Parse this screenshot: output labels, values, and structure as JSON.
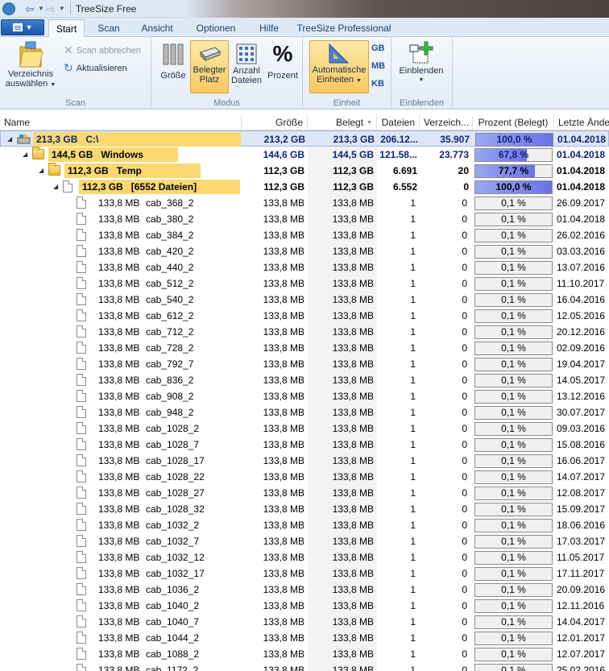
{
  "window": {
    "title": "TreeSize Free"
  },
  "tabs": [
    {
      "label": "Start",
      "active": true
    },
    {
      "label": "Scan",
      "active": false
    },
    {
      "label": "Ansicht",
      "active": false
    },
    {
      "label": "Optionen",
      "active": false
    },
    {
      "label": "Hilfe",
      "active": false
    },
    {
      "label": "TreeSize Professional",
      "active": false
    }
  ],
  "ribbon": {
    "scan": {
      "label": "Scan",
      "select_dir_line1": "Verzeichnis",
      "select_dir_line2": "auswählen",
      "abort": "Scan abbrechen",
      "refresh": "Aktualisieren"
    },
    "modus": {
      "label": "Modus",
      "groesse": "Größe",
      "belegter_line1": "Belegter",
      "belegter_line2": "Platz",
      "anzahl_line1": "Anzahl",
      "anzahl_line2": "Dateien",
      "prozent": "Prozent"
    },
    "einheit": {
      "label": "Einheit",
      "auto_line1": "Automatische",
      "auto_line2": "Einheiten",
      "gb": "GB",
      "mb": "MB",
      "kb": "KB"
    },
    "einblenden": {
      "label": "Einblenden",
      "button": "Einblenden"
    }
  },
  "columns": {
    "name": "Name",
    "groesse": "Größe",
    "belegt": "Belegt",
    "dateien": "Dateien",
    "verzeich": "Verzeich...",
    "prozent": "Prozent (Belegt)",
    "letzte": "Letzte Ände"
  },
  "tree": [
    {
      "level": 0,
      "icon": "drive",
      "label_size": "213,3 GB",
      "label_name": "C:\\",
      "size": "213,2 GB",
      "belegt": "213,3 GB",
      "dateien": "206.12...",
      "verzeich": "35.907",
      "prozent": "100,0 %",
      "pct_value": 100,
      "date": "01.04.2018"
    },
    {
      "level": 1,
      "icon": "folder",
      "label_size": "144,5 GB",
      "label_name": "Windows",
      "size": "144,6 GB",
      "belegt": "144,5 GB",
      "dateien": "121.58...",
      "verzeich": "23.773",
      "prozent": "67,8 %",
      "pct_value": 67.8,
      "date": "01.04.2018"
    },
    {
      "level": 2,
      "icon": "folder",
      "label_size": "112,3 GB",
      "label_name": "Temp",
      "size": "112,3 GB",
      "belegt": "112,3 GB",
      "dateien": "6.691",
      "verzeich": "20",
      "prozent": "77,7 %",
      "pct_value": 77.7,
      "date": "01.04.2018"
    },
    {
      "level": 3,
      "icon": "file",
      "label_size": "112,3 GB",
      "label_name": "[6552 Dateien]",
      "size": "112,3 GB",
      "belegt": "112,3 GB",
      "dateien": "6.552",
      "verzeich": "0",
      "prozent": "100,0 %",
      "pct_value": 100,
      "date": "01.04.2018"
    }
  ],
  "files": [
    {
      "size": "133,8 MB",
      "name": "cab_368_2",
      "date": "26.09.2017"
    },
    {
      "size": "133,8 MB",
      "name": "cab_380_2",
      "date": "01.04.2018"
    },
    {
      "size": "133,8 MB",
      "name": "cab_384_2",
      "date": "26.02.2016"
    },
    {
      "size": "133,8 MB",
      "name": "cab_420_2",
      "date": "03.03.2016"
    },
    {
      "size": "133,8 MB",
      "name": "cab_440_2",
      "date": "13.07.2016"
    },
    {
      "size": "133,8 MB",
      "name": "cab_512_2",
      "date": "11.10.2017"
    },
    {
      "size": "133,8 MB",
      "name": "cab_540_2",
      "date": "16.04.2016"
    },
    {
      "size": "133,8 MB",
      "name": "cab_612_2",
      "date": "12.05.2016"
    },
    {
      "size": "133,8 MB",
      "name": "cab_712_2",
      "date": "20.12.2016"
    },
    {
      "size": "133,8 MB",
      "name": "cab_728_2",
      "date": "02.09.2016"
    },
    {
      "size": "133,8 MB",
      "name": "cab_792_7",
      "date": "19.04.2017"
    },
    {
      "size": "133,8 MB",
      "name": "cab_836_2",
      "date": "14.05.2017"
    },
    {
      "size": "133,8 MB",
      "name": "cab_908_2",
      "date": "13.12.2016"
    },
    {
      "size": "133,8 MB",
      "name": "cab_948_2",
      "date": "30.07.2017"
    },
    {
      "size": "133,8 MB",
      "name": "cab_1028_2",
      "date": "09.03.2016"
    },
    {
      "size": "133,8 MB",
      "name": "cab_1028_7",
      "date": "15.08.2016"
    },
    {
      "size": "133,8 MB",
      "name": "cab_1028_17",
      "date": "16.06.2017"
    },
    {
      "size": "133,8 MB",
      "name": "cab_1028_22",
      "date": "14.07.2017"
    },
    {
      "size": "133,8 MB",
      "name": "cab_1028_27",
      "date": "12.08.2017"
    },
    {
      "size": "133,8 MB",
      "name": "cab_1028_32",
      "date": "15.09.2017"
    },
    {
      "size": "133,8 MB",
      "name": "cab_1032_2",
      "date": "18.06.2016"
    },
    {
      "size": "133,8 MB",
      "name": "cab_1032_7",
      "date": "17.03.2017"
    },
    {
      "size": "133,8 MB",
      "name": "cab_1032_12",
      "date": "11.05.2017"
    },
    {
      "size": "133,8 MB",
      "name": "cab_1032_17",
      "date": "17.11.2017"
    },
    {
      "size": "133,8 MB",
      "name": "cab_1036_2",
      "date": "20.09.2016"
    },
    {
      "size": "133,8 MB",
      "name": "cab_1040_2",
      "date": "12.11.2016"
    },
    {
      "size": "133,8 MB",
      "name": "cab_1040_7",
      "date": "14.04.2017"
    },
    {
      "size": "133,8 MB",
      "name": "cab_1044_2",
      "date": "12.01.2017"
    },
    {
      "size": "133,8 MB",
      "name": "cab_1088_2",
      "date": "12.07.2017"
    },
    {
      "size": "133,8 MB",
      "name": "cab_1172_2",
      "date": "25.02.2016"
    }
  ],
  "file_defaults": {
    "dateien": "1",
    "verzeich": "0",
    "prozent": "0,1 %"
  },
  "colors": {
    "selection_bar": "#fbd970",
    "tree_blue": "#10237a",
    "pct_fill": "#6a72e6"
  }
}
